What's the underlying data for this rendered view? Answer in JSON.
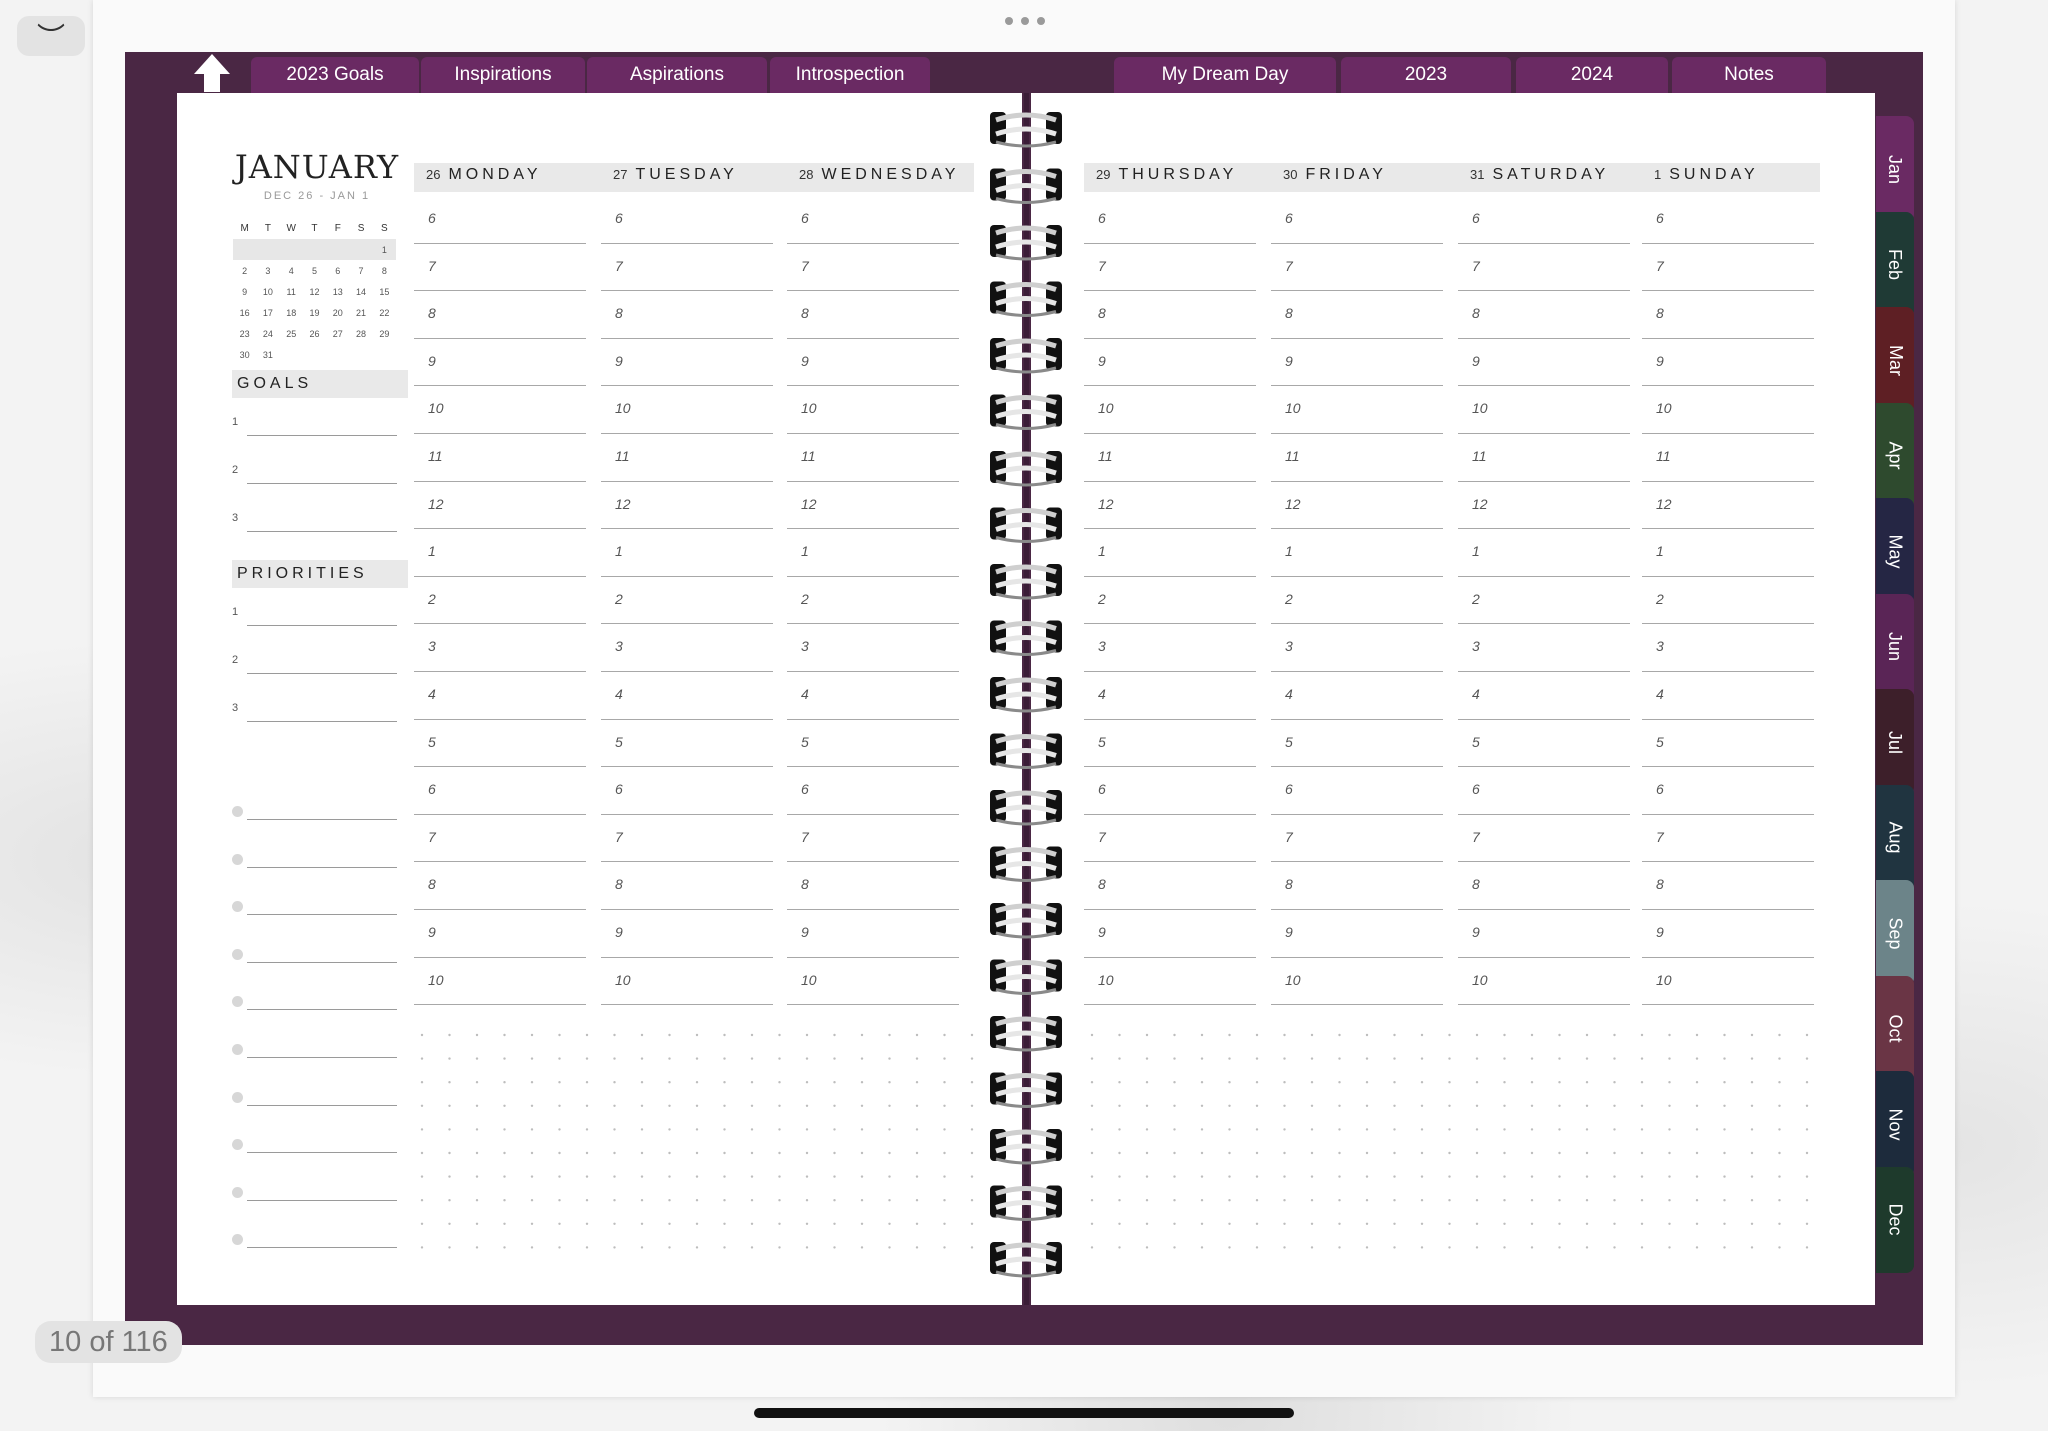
{
  "top_tabs_left": [
    "2023 Goals",
    "Inspirations",
    "Aspirations",
    "Introspection"
  ],
  "top_tabs_right": [
    "My Dream Day",
    "2023",
    "2024",
    "Notes"
  ],
  "side_tabs": [
    {
      "label": "Jan",
      "color": "#6a2a63"
    },
    {
      "label": "Feb",
      "color": "#1f3a35"
    },
    {
      "label": "Mar",
      "color": "#5e1f24"
    },
    {
      "label": "Apr",
      "color": "#2e4a2e"
    },
    {
      "label": "May",
      "color": "#252644"
    },
    {
      "label": "Jun",
      "color": "#5a2556"
    },
    {
      "label": "Jul",
      "color": "#3d1f2a"
    },
    {
      "label": "Aug",
      "color": "#203440"
    },
    {
      "label": "Sep",
      "color": "#6c8489"
    },
    {
      "label": "Oct",
      "color": "#6a3545"
    },
    {
      "label": "Nov",
      "color": "#1d2b3c"
    },
    {
      "label": "Dec",
      "color": "#1e3a2c"
    }
  ],
  "month": {
    "title": "JANUARY",
    "range": "DEC 26 - JAN 1",
    "weekday_letters": [
      "M",
      "T",
      "W",
      "T",
      "F",
      "S",
      "S"
    ],
    "weeks": [
      [
        "",
        "",
        "",
        "",
        "",
        "",
        "1"
      ],
      [
        "2",
        "3",
        "4",
        "5",
        "6",
        "7",
        "8"
      ],
      [
        "9",
        "10",
        "11",
        "12",
        "13",
        "14",
        "15"
      ],
      [
        "16",
        "17",
        "18",
        "19",
        "20",
        "21",
        "22"
      ],
      [
        "23",
        "24",
        "25",
        "26",
        "27",
        "28",
        "29"
      ],
      [
        "30",
        "31",
        "",
        "",
        "",
        "",
        ""
      ]
    ]
  },
  "goals": {
    "title": "GOALS",
    "items": [
      "1",
      "2",
      "3"
    ]
  },
  "priorities": {
    "title": "PRIORITIES",
    "items": [
      "1",
      "2",
      "3"
    ]
  },
  "days_left": [
    {
      "num": "26",
      "name": "MONDAY"
    },
    {
      "num": "27",
      "name": "TUESDAY"
    },
    {
      "num": "28",
      "name": "WEDNESDAY"
    }
  ],
  "days_right": [
    {
      "num": "29",
      "name": "THURSDAY"
    },
    {
      "num": "30",
      "name": "FRIDAY"
    },
    {
      "num": "31",
      "name": "SATURDAY"
    },
    {
      "num": "1",
      "name": "SUNDAY"
    }
  ],
  "hours": [
    "6",
    "7",
    "8",
    "9",
    "10",
    "11",
    "12",
    "1",
    "2",
    "3",
    "4",
    "5",
    "6",
    "7",
    "8",
    "9",
    "10"
  ],
  "page_counter": "10 of 116",
  "colors": {
    "cover": "#4a2744",
    "tab": "#6a2a63"
  }
}
